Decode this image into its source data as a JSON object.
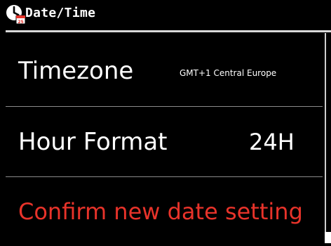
{
  "header": {
    "title": "Date/Time",
    "icon": "clock-calendar-icon",
    "icon_badge": "25"
  },
  "rows": [
    {
      "label": "Timezone",
      "value": "GMT+1 Central Europe"
    },
    {
      "label": "Hour Format",
      "value": "24H"
    },
    {
      "label": "Confirm new date setting",
      "value": ""
    }
  ],
  "colors": {
    "background": "#000000",
    "text": "#ffffff",
    "accent_red": "#e8332a",
    "divider": "#d8d8d8"
  }
}
